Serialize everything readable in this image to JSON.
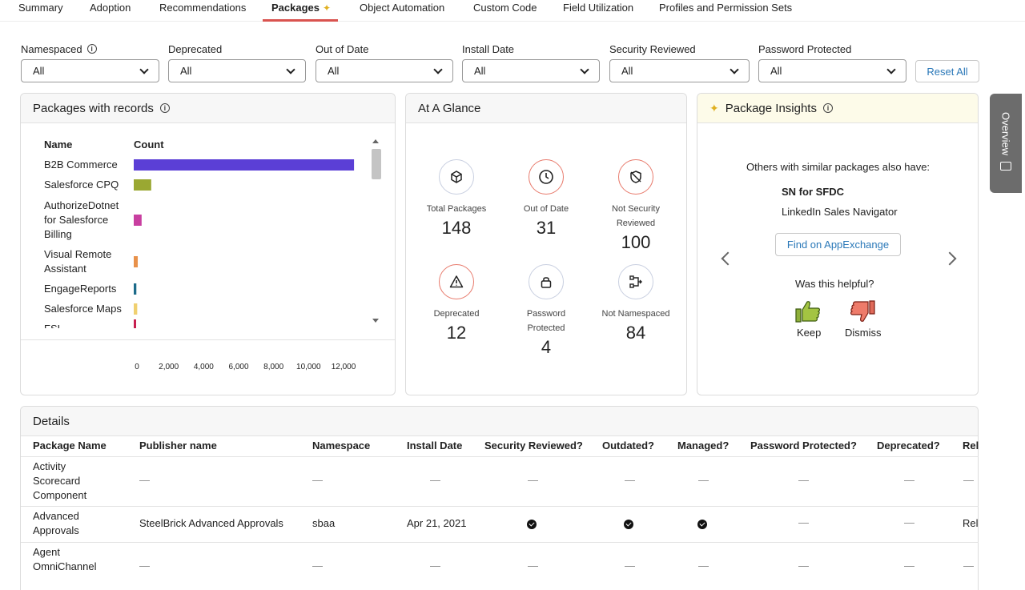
{
  "tabs": [
    {
      "label": "Summary"
    },
    {
      "label": "Adoption"
    },
    {
      "label": "Recommendations"
    },
    {
      "label": "Packages"
    },
    {
      "label": "Object Automation"
    },
    {
      "label": "Custom Code"
    },
    {
      "label": "Field Utilization"
    },
    {
      "label": "Profiles and Permission Sets"
    }
  ],
  "filters": [
    {
      "label": "Namespaced",
      "value": "All"
    },
    {
      "label": "Deprecated",
      "value": "All"
    },
    {
      "label": "Out of Date",
      "value": "All"
    },
    {
      "label": "Install Date",
      "value": "All"
    },
    {
      "label": "Security Reviewed",
      "value": "All"
    },
    {
      "label": "Password Protected",
      "value": "All"
    }
  ],
  "reset_label": "Reset All",
  "packages_card": {
    "title": "Packages with records",
    "col_name": "Name",
    "col_count": "Count"
  },
  "chart_data": {
    "type": "bar",
    "orientation": "horizontal",
    "categories": [
      "B2B Commerce",
      "Salesforce CPQ",
      "AuthorizeDotnet for Salesforce Billing",
      "Visual Remote Assistant",
      "EngageReports",
      "Salesforce Maps",
      "FSL"
    ],
    "values": [
      12600,
      1000,
      450,
      230,
      150,
      200,
      120
    ],
    "colors": [
      "#5b3fd6",
      "#9aa832",
      "#c83fa0",
      "#e8914a",
      "#1d6b8a",
      "#f0d070",
      "#c82050"
    ],
    "ticks": [
      "0",
      "2,000",
      "4,000",
      "6,000",
      "8,000",
      "10,000",
      "12,000"
    ],
    "xlim": [
      0,
      12000
    ]
  },
  "glance": {
    "title": "At A Glance",
    "items": [
      {
        "label": "Total Packages",
        "value": "148",
        "icon": "cube-icon"
      },
      {
        "label": "Out of Date",
        "value": "31",
        "icon": "clock-icon"
      },
      {
        "label": "Not Security Reviewed",
        "value": "100",
        "icon": "shield-off-icon"
      },
      {
        "label": "Deprecated",
        "value": "12",
        "icon": "warning-icon"
      },
      {
        "label": "Password Protected",
        "value": "4",
        "icon": "lock-icon"
      },
      {
        "label": "Not Namespaced",
        "value": "84",
        "icon": "flow-icon"
      }
    ]
  },
  "insights": {
    "title": "Package Insights",
    "intro": "Others with similar packages also have:",
    "item1": "SN for SFDC",
    "item2": "LinkedIn Sales Navigator",
    "button": "Find on AppExchange",
    "helpful": "Was this helpful?",
    "keep": "Keep",
    "dismiss": "Dismiss"
  },
  "overview_label": "Overview",
  "details": {
    "title": "Details",
    "columns": [
      "Package Name",
      "Publisher name",
      "Namespace",
      "Install Date",
      "Security Reviewed?",
      "Outdated?",
      "Managed?",
      "Password Protected?",
      "Deprecated?",
      "Rel"
    ],
    "rows": [
      {
        "name": "Activity Scorecard Component",
        "publisher": "—",
        "namespace": "—",
        "install": "—",
        "security": "—",
        "outdated": "—",
        "managed": "—",
        "password": "—",
        "deprecated": "—",
        "rel": "—"
      },
      {
        "name": "Advanced Approvals",
        "publisher": "SteelBrick Advanced Approvals",
        "namespace": "sbaa",
        "install": "Apr 21, 2021",
        "security": "check",
        "outdated": "check",
        "managed": "check",
        "password": "—",
        "deprecated": "—",
        "rel": "Rel"
      },
      {
        "name": "Agent OmniChannel",
        "publisher": "—",
        "namespace": "—",
        "install": "—",
        "security": "—",
        "outdated": "—",
        "managed": "—",
        "password": "—",
        "deprecated": "—",
        "rel": "—"
      }
    ]
  }
}
